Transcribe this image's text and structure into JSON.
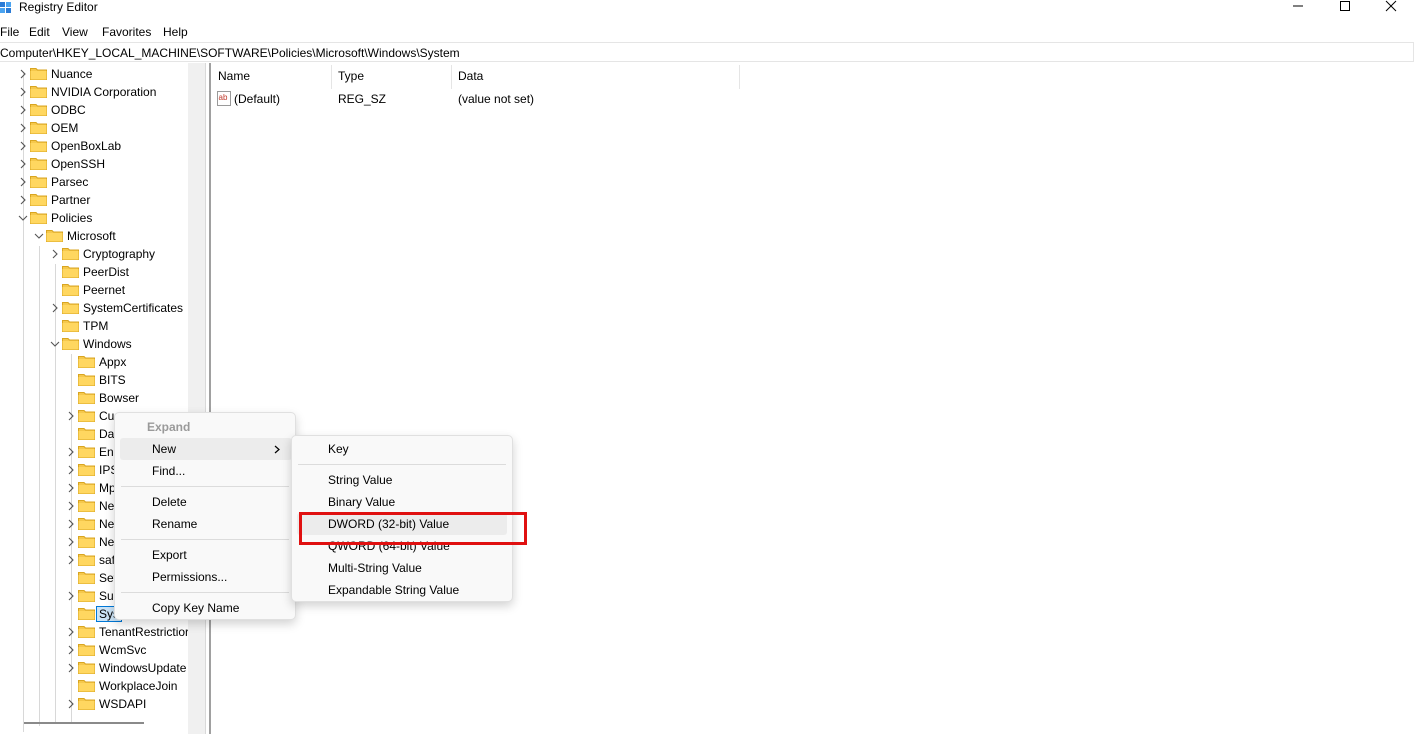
{
  "window": {
    "title": "Registry Editor",
    "icon": "registry-editor-icon"
  },
  "menubar": {
    "items": [
      "File",
      "Edit",
      "View",
      "Favorites",
      "Help"
    ]
  },
  "address": {
    "path": "Computer\\HKEY_LOCAL_MACHINE\\SOFTWARE\\Policies\\Microsoft\\Windows\\System"
  },
  "tree": {
    "level1": [
      "Nuance",
      "NVIDIA Corporation",
      "ODBC",
      "OEM",
      "OpenBoxLab",
      "OpenSSH",
      "Parsec",
      "Partner",
      "Policies"
    ],
    "microsoft": "Microsoft",
    "level3": [
      "Cryptography",
      "PeerDist",
      "Peernet",
      "SystemCertificates",
      "TPM",
      "Windows"
    ],
    "windows_children": [
      "Appx",
      "BITS",
      "Bowser",
      "CurrentVersion",
      "Da",
      "En",
      "IPS",
      "Mp",
      "Ne",
      "Ne",
      "Ne",
      "saf",
      "Set",
      "Su",
      "Sys",
      "TenantRestriction",
      "WcmSvc",
      "WindowsUpdate",
      "WorkplaceJoin",
      "WSDAPI"
    ],
    "windows_children_visible": [
      "Appx",
      "BITS",
      "Bowser",
      "Cu",
      "Da",
      "En",
      "IPS",
      "Mp",
      "Ne",
      "Ne",
      "Ne",
      "saf",
      "Set",
      "Su",
      "Sys",
      "TenantRestrictior",
      "WcmSvc",
      "WindowsUpdate",
      "WorkplaceJoin",
      "WSDAPI"
    ]
  },
  "list": {
    "columns": [
      "Name",
      "Type",
      "Data"
    ],
    "rows": [
      {
        "name": "(Default)",
        "type": "REG_SZ",
        "data": "(value not set)"
      }
    ]
  },
  "context_menu": {
    "items": [
      "Expand",
      "New",
      "Find...",
      "Delete",
      "Rename",
      "Export",
      "Permissions...",
      "Copy Key Name"
    ]
  },
  "submenu": {
    "items": [
      "Key",
      "String Value",
      "Binary Value",
      "DWORD (32-bit) Value",
      "QWORD (64-bit) Value",
      "Multi-String Value",
      "Expandable String Value"
    ]
  },
  "colors": {
    "folder": "#f5c84c",
    "highlight": "#e01010",
    "selection": "#cce4f7"
  }
}
